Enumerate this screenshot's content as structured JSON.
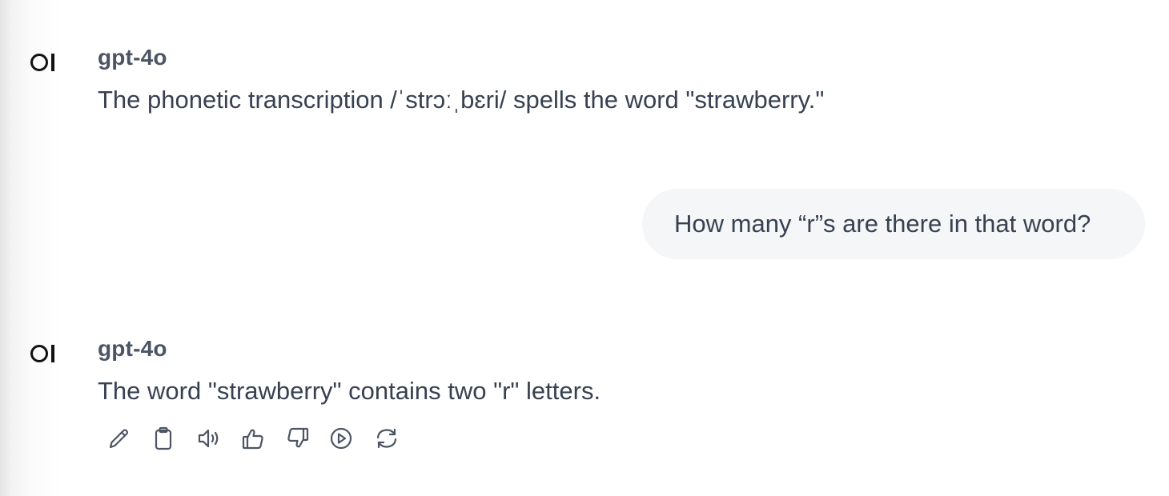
{
  "messages": [
    {
      "role": "assistant",
      "model": "gpt-4o",
      "text": "The phonetic transcription /ˈstrɔːˌbɛri/ spells the word \"strawberry.\""
    },
    {
      "role": "user",
      "text": "How many “r”s are there in that word?"
    },
    {
      "role": "assistant",
      "model": "gpt-4o",
      "text": "The word \"strawberry\" contains two \"r\" letters."
    }
  ],
  "actions": [
    {
      "icon": "pencil-icon",
      "name": "edit"
    },
    {
      "icon": "clipboard-icon",
      "name": "copy"
    },
    {
      "icon": "speaker-icon",
      "name": "read-aloud"
    },
    {
      "icon": "thumbs-up-icon",
      "name": "good-response"
    },
    {
      "icon": "thumbs-down-icon",
      "name": "bad-response"
    },
    {
      "icon": "play-circle-icon",
      "name": "continue"
    },
    {
      "icon": "refresh-icon",
      "name": "regenerate"
    }
  ]
}
